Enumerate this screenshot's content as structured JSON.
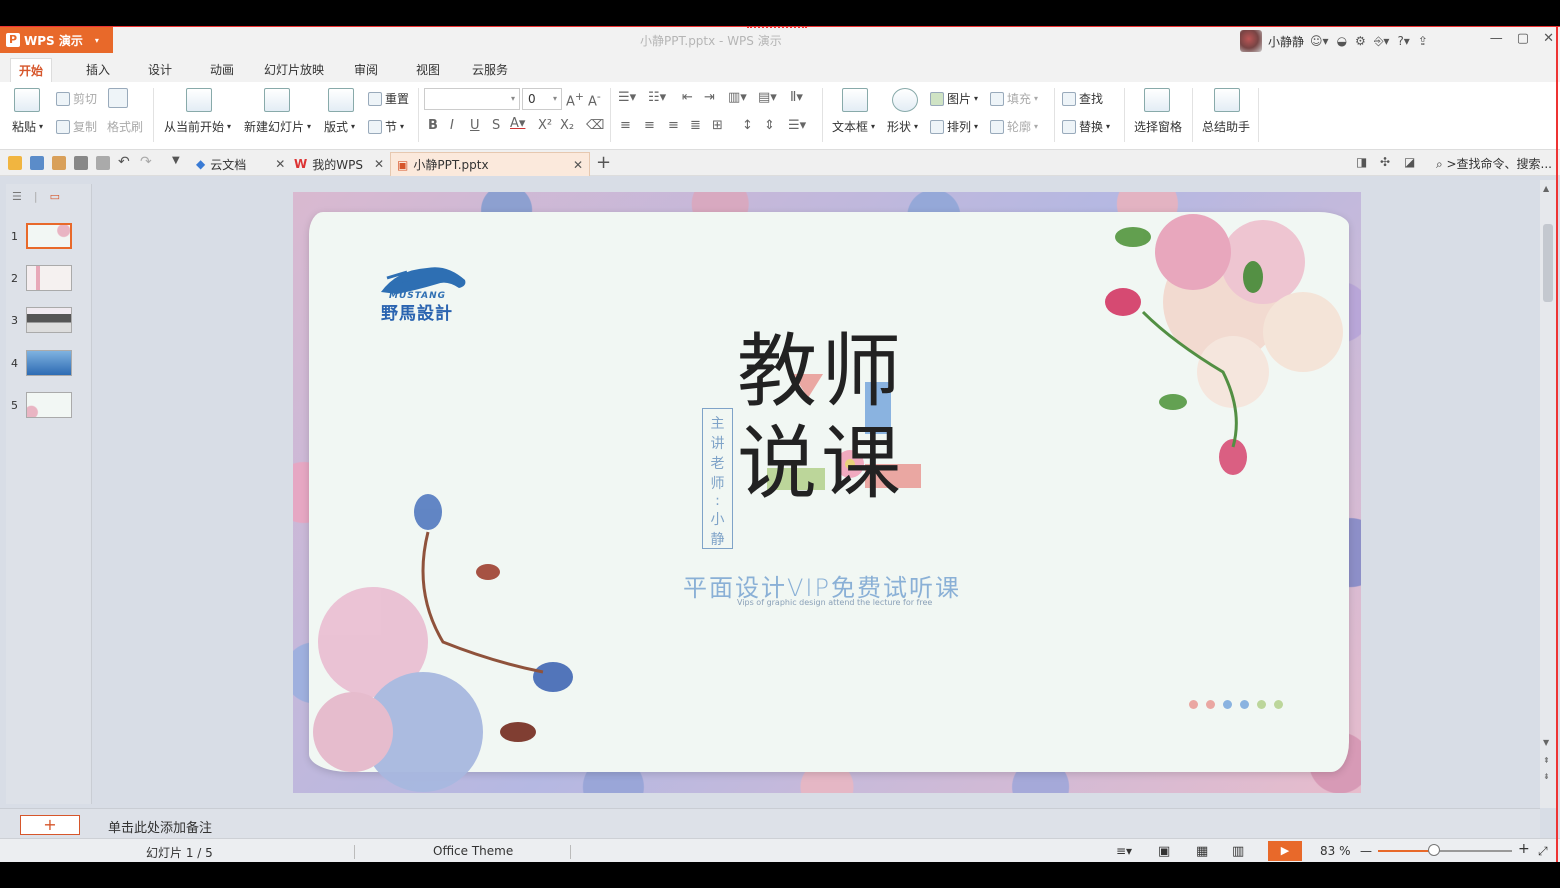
{
  "title_bar": {
    "app_button": "WPS 演示",
    "document_title": "小静PPT.pptx - WPS 演示",
    "user_name": "小静静"
  },
  "menu_tabs": [
    "开始",
    "插入",
    "设计",
    "动画",
    "幻灯片放映",
    "审阅",
    "视图",
    "云服务"
  ],
  "ribbon": {
    "paste": "粘贴",
    "cut": "剪切",
    "copy": "复制",
    "format_painter": "格式刷",
    "play_from_current": "从当前开始",
    "new_slide": "新建幻灯片",
    "layout": "版式",
    "reset": "重置",
    "section": "节",
    "font_size": "0",
    "textbox": "文本框",
    "shape": "形状",
    "picture": "图片",
    "fill": "填充",
    "arrange": "排列",
    "outline": "轮廓",
    "find": "查找",
    "replace": "替换",
    "selection_pane": "选择窗格",
    "summary_assistant": "总结助手"
  },
  "doc_tabs": [
    {
      "label": "云文档"
    },
    {
      "label": "我的WPS"
    },
    {
      "label": "小静PPT.pptx"
    }
  ],
  "search_command": ">查找命令、搜索...",
  "slides": [
    "1",
    "2",
    "3",
    "4",
    "5"
  ],
  "slide": {
    "logo_en": "MUSTANG",
    "logo_cn": "野馬設計",
    "title_line1": "教师",
    "title_line2": "说课",
    "vertical_text": [
      "主",
      "讲",
      "老",
      "师",
      ":",
      "小",
      "静"
    ],
    "subtitle": "平面设计VIP免费试听课",
    "subtitle_en": "Vips of graphic design attend the lecture for free",
    "dot_colors": [
      "#eaa7a2",
      "#eaa7a2",
      "#8ab3e0",
      "#8ab3e0",
      "#bcd69a",
      "#bcd69a"
    ]
  },
  "notes_placeholder": "单击此处添加备注",
  "status": {
    "slide_counter": "幻灯片 1 / 5",
    "theme": "Office Theme",
    "zoom": "83 %",
    "zoom_fraction": 0.42
  },
  "colors": {
    "accent": "#e8692a"
  }
}
